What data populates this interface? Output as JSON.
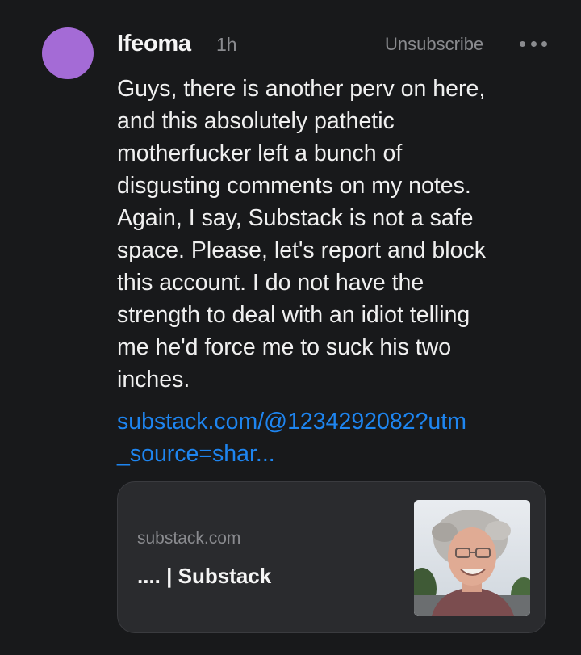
{
  "post": {
    "author": "Ifeoma",
    "time": "1h",
    "unsubscribe_label": "Unsubscribe",
    "avatar_color": "#a46bd6",
    "more_icon": "more-horizontal-icon",
    "body": "Guys, there is another perv on here,\nand this absolutely pathetic\nmotherfucker left a bunch of\ndisgusting comments on my notes.\nAgain, I say, Substack is not a safe\nspace. Please, let's report and block\nthis account. I do not have the\nstrength to deal with an idiot telling\nme he'd force me to suck his two\ninches.",
    "link_text": "substack.com/@1234292082?utm\n_source=shar...",
    "link_color": "#1e85f0"
  },
  "card": {
    "domain": "substack.com",
    "title": ".... | Substack"
  }
}
